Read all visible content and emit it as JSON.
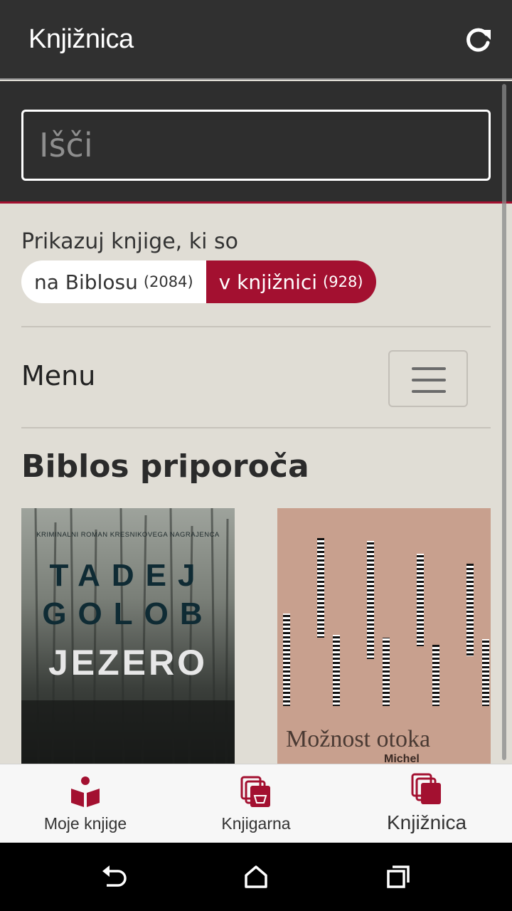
{
  "appbar": {
    "title": "Knjižnica",
    "refresh_icon": "refresh-icon"
  },
  "search": {
    "placeholder": "Išči",
    "value": ""
  },
  "filter": {
    "label": "Prikazuj knjige, ki so",
    "options": [
      {
        "label": "na Biblosu",
        "count": "(2084)",
        "selected": false
      },
      {
        "label": "v knjižnici",
        "count": "(928)",
        "selected": true
      }
    ]
  },
  "menu": {
    "label": "Menu",
    "icon": "hamburger-icon"
  },
  "recommended": {
    "title": "Biblos priporoča",
    "books": [
      {
        "tagline": "KRIMINALNI ROMAN KRESNIKOVEGA NAGRAJENCA",
        "author_line1": "TADEJ",
        "author_line2": "GOLOB",
        "title": "JEZERO"
      },
      {
        "title": "Možnost otoka",
        "author": "Michel"
      }
    ]
  },
  "tabs": [
    {
      "label": "Moje knjige",
      "icon": "open-book-icon",
      "active": false
    },
    {
      "label": "Knjigarna",
      "icon": "bookstore-icon",
      "active": false
    },
    {
      "label": "Knjižnica",
      "icon": "library-icon",
      "active": true
    }
  ],
  "colors": {
    "accent": "#a31030",
    "appbar": "#303030",
    "background": "#e0ddd5"
  },
  "system_nav": [
    "back-icon",
    "home-icon",
    "recents-icon"
  ]
}
